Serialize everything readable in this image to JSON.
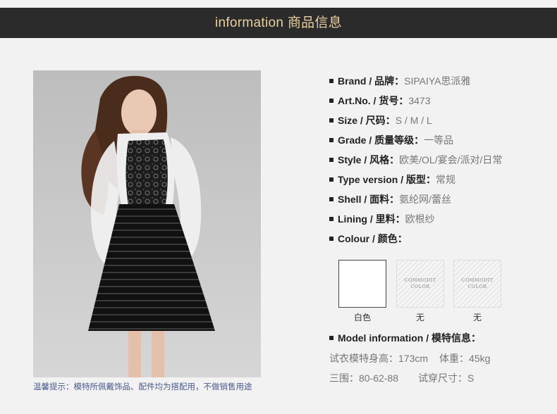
{
  "header": {
    "title": "information 商品信息"
  },
  "specs": [
    {
      "label": "Brand / 品牌：",
      "value": "SIPAIYA思派雅"
    },
    {
      "label": "Art.No. / 货号：",
      "value": "3473"
    },
    {
      "label": "Size / 尺码：",
      "value": "S / M / L"
    },
    {
      "label": "Grade / 质量等级：",
      "value": "一等品"
    },
    {
      "label": "Style / 风格：",
      "value": "欧美/OL/宴会/派对/日常"
    },
    {
      "label": "Type version / 版型：",
      "value": "常规"
    },
    {
      "label": "Shell / 面料：",
      "value": "氨纶网/蕾丝"
    },
    {
      "label": "Lining / 里料：",
      "value": "欧根纱"
    },
    {
      "label": "Colour / 颜色：",
      "value": ""
    }
  ],
  "colours": [
    {
      "label": "白色",
      "swatch": "#ffffff",
      "placeholder": false,
      "placeholder_text": ""
    },
    {
      "label": "无",
      "swatch": "",
      "placeholder": true,
      "placeholder_text": "COMMODIT COLOR"
    },
    {
      "label": "无",
      "swatch": "",
      "placeholder": true,
      "placeholder_text": "COMMODIT COLOR"
    }
  ],
  "model": {
    "title": "Model information / 模特信息：",
    "height": "试衣模特身高：173cm",
    "weight": "体重：45kg",
    "measurements": "三围：80-62-88",
    "size": "试穿尺寸：S"
  },
  "note": "温馨提示：模特所佩戴饰品、配件均为搭配用，不做销售用途",
  "colors": {
    "header_bg": "#2b2b2b",
    "header_text": "#e8cfa0",
    "page_bg": "#f2f2f2"
  }
}
